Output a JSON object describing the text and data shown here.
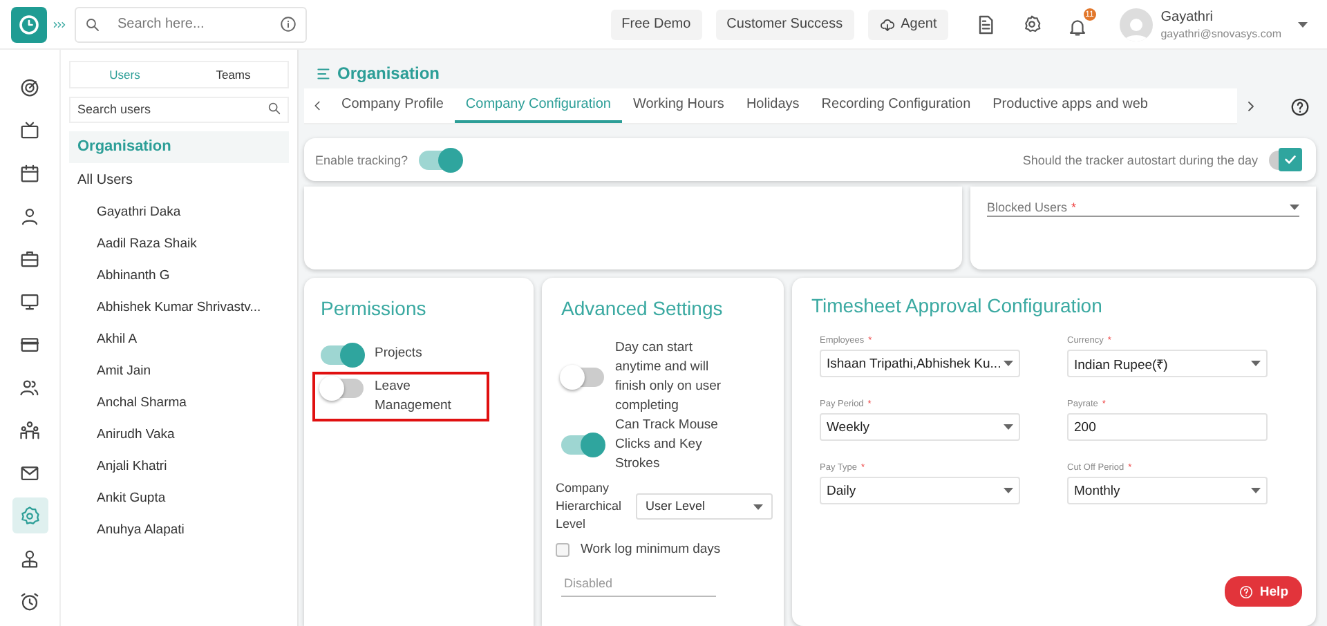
{
  "header": {
    "search": {
      "placeholder": "Search here..."
    },
    "buttons": [
      {
        "label": "Free Demo",
        "kind": "plain"
      },
      {
        "label": "Customer Success",
        "kind": "plain"
      },
      {
        "label": "Agent",
        "kind": "cloud"
      }
    ],
    "notifications": "11",
    "user": {
      "name": "Gayathri",
      "email": "gayathri@snovasys.com"
    }
  },
  "nav": [
    {
      "kind": "target",
      "selected": false
    },
    {
      "kind": "tv",
      "selected": false
    },
    {
      "kind": "calendar",
      "selected": false
    },
    {
      "kind": "person",
      "selected": false
    },
    {
      "kind": "briefcase",
      "selected": false
    },
    {
      "kind": "monitor",
      "selected": false
    },
    {
      "kind": "card",
      "selected": false
    },
    {
      "kind": "people",
      "selected": false
    },
    {
      "kind": "org",
      "selected": false
    },
    {
      "kind": "mail",
      "selected": false
    },
    {
      "kind": "gear",
      "selected": true
    },
    {
      "kind": "badge",
      "selected": false
    },
    {
      "kind": "alarm",
      "selected": false
    }
  ],
  "users_panel": {
    "tabs": [
      {
        "label": "Users",
        "selected": true
      },
      {
        "label": "Teams",
        "selected": false
      }
    ],
    "search": {
      "placeholder": "Search users"
    },
    "groups": [
      {
        "label": "Organisation",
        "selected": true
      },
      {
        "label": "All Users",
        "selected": false
      }
    ],
    "users": [
      "Gayathri Daka",
      "Aadil Raza Shaik",
      "Abhinanth G",
      "Abhishek Kumar Shrivastv...",
      "Akhil A",
      "Amit Jain",
      "Anchal Sharma",
      "Anirudh Vaka",
      "Anjali Khatri",
      "Ankit Gupta",
      "Anuhya Alapati"
    ]
  },
  "page": {
    "title": "Organisation",
    "tabs": [
      {
        "label": "Company Profile",
        "selected": false
      },
      {
        "label": "Company Configuration",
        "selected": true
      },
      {
        "label": "Working Hours",
        "selected": false
      },
      {
        "label": "Holidays",
        "selected": false
      },
      {
        "label": "Recording Configuration",
        "selected": false
      },
      {
        "label": "Productive apps and web",
        "selected": false
      }
    ],
    "tracking": {
      "label": "Enable tracking?",
      "on": true
    },
    "autostart": {
      "label": "Should the tracker autostart during the day",
      "checked": true
    },
    "blocked_users": {
      "label": "Blocked Users",
      "mark": "*"
    },
    "permissions": {
      "title": "Permissions",
      "items": [
        {
          "label": "Projects",
          "on": true,
          "highlighted": false
        },
        {
          "label": "Leave Management",
          "on": false,
          "highlighted": true
        }
      ]
    },
    "advanced": {
      "title": "Advanced Settings",
      "toggles": [
        {
          "label": "Day can start anytime and will finish only on user completing",
          "on": false
        },
        {
          "label": "Can Track Mouse Clicks and Key Strokes",
          "on": true
        }
      ],
      "hierarchy": {
        "label": "Company Hierarchical Level",
        "value": "User Level"
      },
      "worklog": {
        "label": "Work log minimum days",
        "checked": false
      },
      "worklog_field": {
        "placeholder": "Disabled"
      }
    },
    "timesheet": {
      "title": "Timesheet Approval Configuration",
      "fields": [
        {
          "label": "Employees",
          "mark": "*",
          "value": "Ishaan Tripathi,Abhishek Ku...",
          "kind": "select"
        },
        {
          "label": "Currency",
          "mark": "*",
          "value": "Indian Rupee(₹)",
          "kind": "select"
        },
        {
          "label": "Pay Period",
          "mark": "*",
          "value": "Weekly",
          "kind": "select"
        },
        {
          "label": "Payrate",
          "mark": "*",
          "value": "200",
          "kind": "input"
        },
        {
          "label": "Pay Type",
          "mark": "*",
          "value": "Daily",
          "kind": "select"
        },
        {
          "label": "Cut Off Period",
          "mark": "*",
          "value": "Monthly",
          "kind": "select"
        }
      ]
    }
  },
  "help_button": "Help"
}
